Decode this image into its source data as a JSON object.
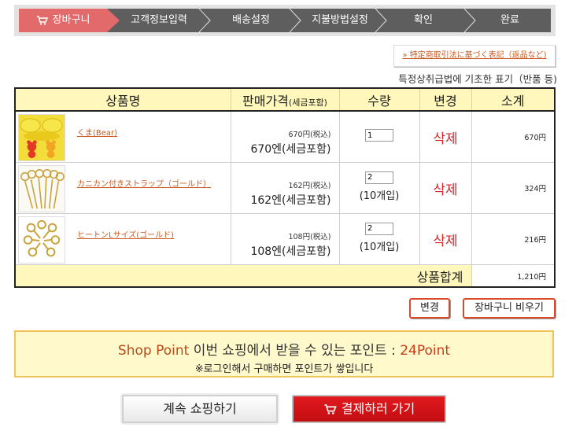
{
  "steps": [
    {
      "label": "장바구니",
      "active": true
    },
    {
      "label": "고객정보입력",
      "active": false
    },
    {
      "label": "배송설정",
      "active": false
    },
    {
      "label": "지불방법설정",
      "active": false
    },
    {
      "label": "확인",
      "active": false
    },
    {
      "label": "완료",
      "active": false
    }
  ],
  "tokusho": {
    "link": "» 特定商取引法に基づく表記（返品など)",
    "note": "특정상취급법에 기초한 표기（반품 등)"
  },
  "table": {
    "headers": {
      "product": "상품명",
      "price": "판매가격",
      "price_small": "(세금포함)",
      "qty": "수량",
      "change": "변경",
      "subtotal": "소계"
    },
    "rows": [
      {
        "name": "くま(Bear)",
        "price_jpy": "670円(税込)",
        "price_krw": "670엔(세금포함)",
        "qty": "1",
        "qty_note": "",
        "delete": "삭제",
        "subtotal": "670円",
        "thumb": "bear-candy-icon"
      },
      {
        "name": "カニカン付きストラップ（ゴールド）",
        "price_jpy": "162円(税込)",
        "price_krw": "162엔(세금포함)",
        "qty": "2",
        "qty_note": "(10개입)",
        "delete": "삭제",
        "subtotal": "324円",
        "thumb": "strap-icon"
      },
      {
        "name": "ヒートンLサイズ(ゴールド)",
        "price_jpy": "108円(税込)",
        "price_krw": "108엔(세금포함)",
        "qty": "2",
        "qty_note": "(10개입)",
        "delete": "삭제",
        "subtotal": "216円",
        "thumb": "eye-pin-icon"
      }
    ],
    "total_label": "상품합계",
    "total_value": "1,210円"
  },
  "actions": {
    "update": "변경",
    "empty_cart": "장바구니 비우기"
  },
  "point": {
    "brand": "Shop Point",
    "text": " 이번 쇼핑에서 받을 수 있는 포인트 : ",
    "value": "24Point",
    "note": "※로그인해서 구매하면 포인트가 쌓입니다"
  },
  "buttons": {
    "continue": "계속 쇼핑하기",
    "checkout": "결제하러 가기"
  },
  "colors": {
    "step_active": "#e36a6a",
    "step_bg": "#5e5e5e",
    "delete_red": "#d8262a",
    "checkout_red": "#d0151a",
    "header_yellow": "#fff7bb"
  }
}
